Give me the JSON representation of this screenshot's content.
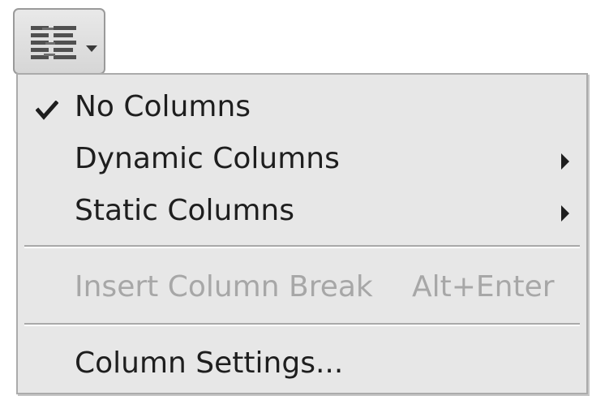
{
  "toolbar": {
    "button_icon": "columns-icon",
    "dropdown_icon": "chevron-down-icon"
  },
  "menu": {
    "items": [
      {
        "label": "No Columns",
        "checked": true
      },
      {
        "label": "Dynamic Columns",
        "submenu": true
      },
      {
        "label": "Static Columns",
        "submenu": true
      },
      {
        "label": "Insert Column Break",
        "shortcut": "Alt+Enter",
        "disabled": true
      },
      {
        "label": "Column Settings..."
      }
    ]
  },
  "colors": {
    "menu_background": "#e7e7e7",
    "text": "#1e1e1e",
    "disabled_text": "#a7a7a7"
  }
}
